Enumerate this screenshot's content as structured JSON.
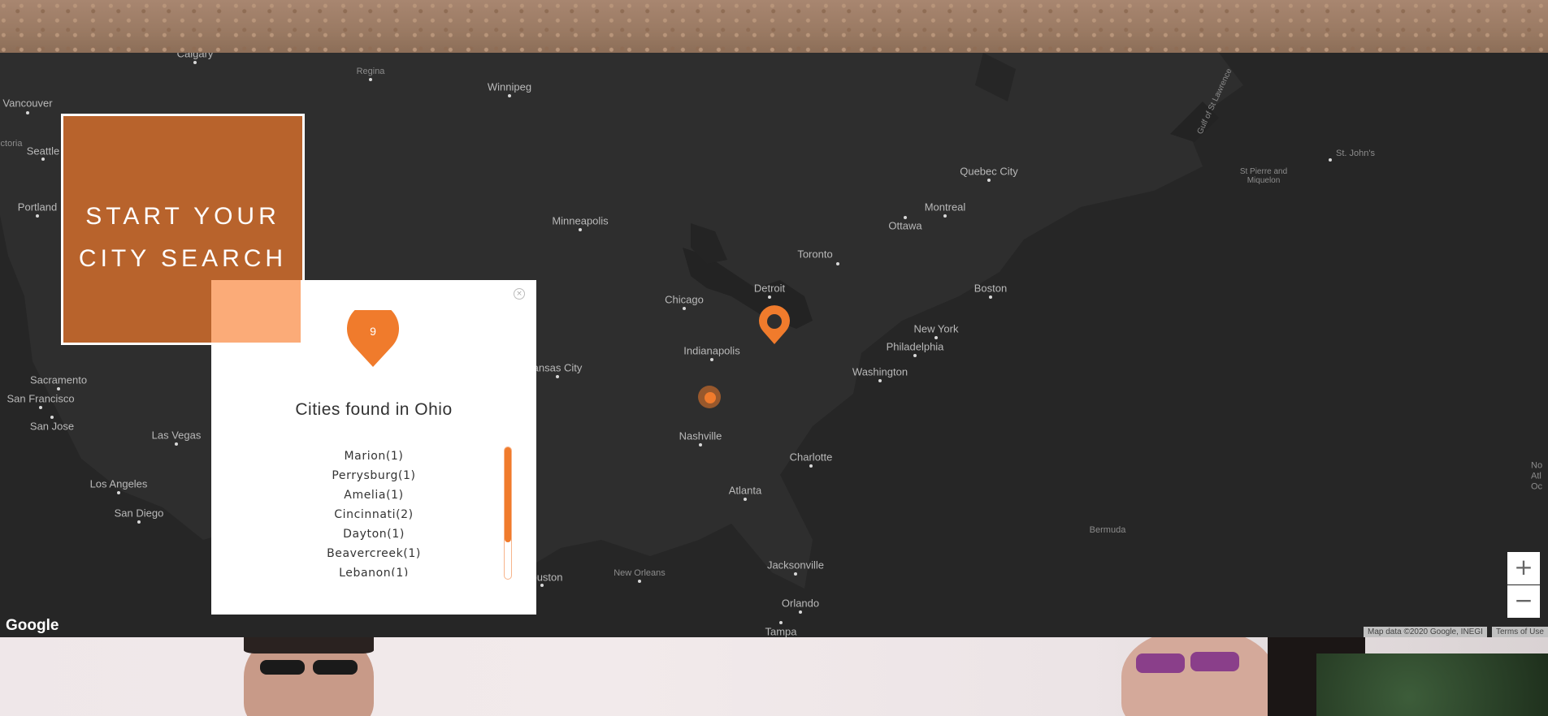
{
  "cta": {
    "line1": "START YOUR",
    "line2": "CITY SEARCH"
  },
  "popup": {
    "close_icon": "close-icon",
    "marker_count": "9",
    "title": "Cities found in Ohio",
    "cities": [
      "Marion(1)",
      "Perrysburg(1)",
      "Amelia(1)",
      "Cincinnati(2)",
      "Dayton(1)",
      "Beavercreek(1)",
      "Lebanon(1)"
    ],
    "scroll_position": 0.0
  },
  "map": {
    "labels": [
      "Calgary",
      "Regina",
      "Winnipeg",
      "Vancouver",
      "ctoria",
      "Seattle",
      "Portland",
      "Minneapolis",
      "Quebec City",
      "Montreal",
      "Ottawa",
      "Toronto",
      "Detroit",
      "Chicago",
      "Boston",
      "New York",
      "Philadelphia",
      "Indianapolis",
      "Washington",
      "ansas City",
      "Sacramento",
      "San Francisco",
      "San Jose",
      "Las Vegas",
      "Los Angeles",
      "San Diego",
      "Nashville",
      "Charlotte",
      "Atlanta",
      "ouston",
      "New Orleans",
      "Jacksonville",
      "Orlando",
      "Tampa",
      "St. John's",
      "St Pierre and Miquelon",
      "Gulf of St Lawrence",
      "Bermuda",
      "No Atl Oc"
    ],
    "zoom_in": "+",
    "zoom_out": "−",
    "logo": "Google",
    "map_data": "Map data ©2020 Google, INEGI",
    "terms": "Terms of Use"
  },
  "colors": {
    "accent": "#f07b2c",
    "cta_bg": "#b8632c",
    "map_bg": "#262626"
  }
}
